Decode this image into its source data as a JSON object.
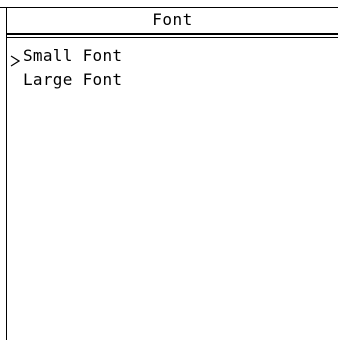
{
  "header": {
    "title": "Font"
  },
  "menu": {
    "selected_index": 0,
    "items": [
      {
        "label": "Small Font",
        "selected": true
      },
      {
        "label": "Large Font",
        "selected": false
      }
    ]
  },
  "colors": {
    "foreground": "#000000",
    "background": "#ffffff"
  },
  "icons": {
    "selection": "selection-cursor-icon"
  }
}
